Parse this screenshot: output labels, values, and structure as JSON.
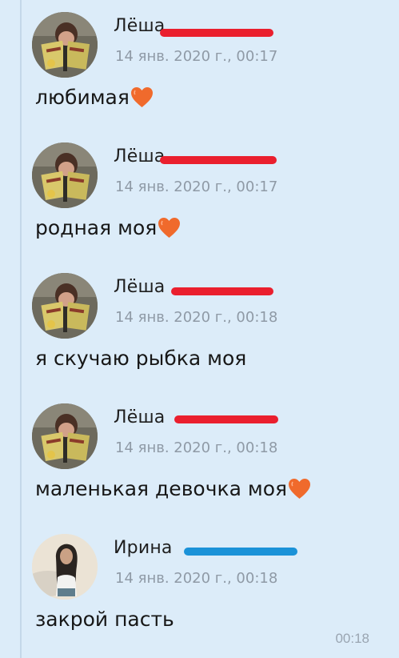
{
  "colors": {
    "background": "#dcecf9",
    "red_redaction": "#ea1f2e",
    "blue_redaction": "#1b92d8",
    "heart": "#f06a2c"
  },
  "messages": [
    {
      "sender": "Лёша",
      "timestamp": "14 янв. 2020 г., 00:17",
      "text": "любимая",
      "has_heart": true,
      "avatar": "boy-reading-book",
      "redaction_color": "red"
    },
    {
      "sender": "Лёша",
      "timestamp": "14 янв. 2020 г., 00:17",
      "text": "родная моя",
      "has_heart": true,
      "avatar": "boy-reading-book",
      "redaction_color": "red"
    },
    {
      "sender": "Лёша",
      "timestamp": "14 янв. 2020 г., 00:18",
      "text": "я скучаю рыбка моя",
      "has_heart": false,
      "avatar": "boy-reading-book",
      "redaction_color": "red"
    },
    {
      "sender": "Лёша",
      "timestamp": "14 янв. 2020 г., 00:18",
      "text": "маленькая девочка моя",
      "has_heart": true,
      "avatar": "boy-reading-book",
      "redaction_color": "red"
    },
    {
      "sender": "Ирина",
      "timestamp": "14 янв. 2020 г., 00:18",
      "text": "закрой пасть",
      "has_heart": false,
      "avatar": "girl-long-hair",
      "redaction_color": "blue"
    }
  ],
  "footer_time": "00:18"
}
